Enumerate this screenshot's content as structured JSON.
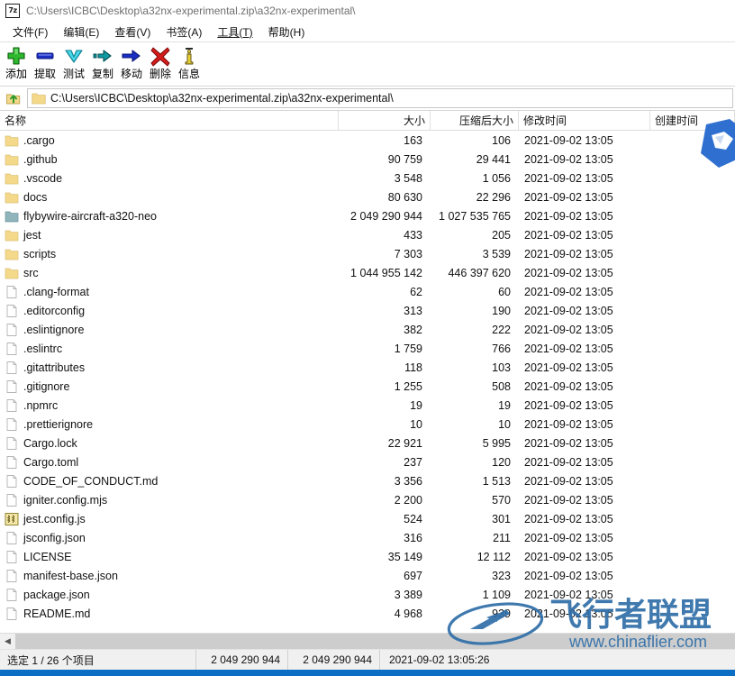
{
  "window": {
    "title": "C:\\Users\\ICBC\\Desktop\\a32nx-experimental.zip\\a32nx-experimental\\",
    "app_icon_text": "7z"
  },
  "menubar": {
    "items": [
      {
        "label": "文件(F)",
        "name": "menu-file"
      },
      {
        "label": "编辑(E)",
        "name": "menu-edit"
      },
      {
        "label": "查看(V)",
        "name": "menu-view"
      },
      {
        "label": "书签(A)",
        "name": "menu-bookmarks"
      },
      {
        "label": "工具(T)",
        "name": "menu-tools"
      },
      {
        "label": "帮助(H)",
        "name": "menu-help"
      }
    ]
  },
  "toolbar": {
    "buttons": [
      {
        "label": "添加",
        "icon": "plus-icon",
        "name": "toolbar-add"
      },
      {
        "label": "提取",
        "icon": "extract-icon",
        "name": "toolbar-extract"
      },
      {
        "label": "测试",
        "icon": "chevron-down-icon",
        "name": "toolbar-test"
      },
      {
        "label": "复制",
        "icon": "copy-arrow-icon",
        "name": "toolbar-copy"
      },
      {
        "label": "移动",
        "icon": "move-arrow-icon",
        "name": "toolbar-move"
      },
      {
        "label": "删除",
        "icon": "delete-x-icon",
        "name": "toolbar-delete"
      },
      {
        "label": "信息",
        "icon": "info-icon",
        "name": "toolbar-info"
      }
    ]
  },
  "addressbar": {
    "up_icon": "up-folder-icon",
    "folder_icon": "folder-icon",
    "path": "C:\\Users\\ICBC\\Desktop\\a32nx-experimental.zip\\a32nx-experimental\\"
  },
  "columns": [
    {
      "key": "name",
      "label": "名称",
      "align": "left"
    },
    {
      "key": "size",
      "label": "大小",
      "align": "right"
    },
    {
      "key": "psize",
      "label": "压缩后大小",
      "align": "right"
    },
    {
      "key": "mtime",
      "label": "修改时间",
      "align": "left"
    },
    {
      "key": "ctime",
      "label": "创建时间",
      "align": "left"
    }
  ],
  "rows": [
    {
      "name": ".cargo",
      "icon": "folder-icon",
      "size": "163",
      "psize": "106",
      "mtime": "2021-09-02 13:05",
      "ctime": "",
      "selected": false
    },
    {
      "name": ".github",
      "icon": "folder-icon",
      "size": "90 759",
      "psize": "29 441",
      "mtime": "2021-09-02 13:05",
      "ctime": "",
      "selected": false
    },
    {
      "name": ".vscode",
      "icon": "folder-icon",
      "size": "3 548",
      "psize": "1 056",
      "mtime": "2021-09-02 13:05",
      "ctime": "",
      "selected": false
    },
    {
      "name": "docs",
      "icon": "folder-icon",
      "size": "80 630",
      "psize": "22 296",
      "mtime": "2021-09-02 13:05",
      "ctime": "",
      "selected": false
    },
    {
      "name": "flybywire-aircraft-a320-neo",
      "icon": "folder-selected-icon",
      "size": "2 049 290 944",
      "psize": "1 027 535 765",
      "mtime": "2021-09-02 13:05",
      "ctime": "",
      "selected": true
    },
    {
      "name": "jest",
      "icon": "folder-icon",
      "size": "433",
      "psize": "205",
      "mtime": "2021-09-02 13:05",
      "ctime": "",
      "selected": false
    },
    {
      "name": "scripts",
      "icon": "folder-icon",
      "size": "7 303",
      "psize": "3 539",
      "mtime": "2021-09-02 13:05",
      "ctime": "",
      "selected": false
    },
    {
      "name": "src",
      "icon": "folder-icon",
      "size": "1 044 955 142",
      "psize": "446 397 620",
      "mtime": "2021-09-02 13:05",
      "ctime": "",
      "selected": false
    },
    {
      "name": ".clang-format",
      "icon": "file-icon",
      "size": "62",
      "psize": "60",
      "mtime": "2021-09-02 13:05",
      "ctime": "",
      "selected": false
    },
    {
      "name": ".editorconfig",
      "icon": "file-icon",
      "size": "313",
      "psize": "190",
      "mtime": "2021-09-02 13:05",
      "ctime": "",
      "selected": false
    },
    {
      "name": ".eslintignore",
      "icon": "file-icon",
      "size": "382",
      "psize": "222",
      "mtime": "2021-09-02 13:05",
      "ctime": "",
      "selected": false
    },
    {
      "name": ".eslintrc",
      "icon": "file-icon",
      "size": "1 759",
      "psize": "766",
      "mtime": "2021-09-02 13:05",
      "ctime": "",
      "selected": false
    },
    {
      "name": ".gitattributes",
      "icon": "file-icon",
      "size": "118",
      "psize": "103",
      "mtime": "2021-09-02 13:05",
      "ctime": "",
      "selected": false
    },
    {
      "name": ".gitignore",
      "icon": "file-icon",
      "size": "1 255",
      "psize": "508",
      "mtime": "2021-09-02 13:05",
      "ctime": "",
      "selected": false
    },
    {
      "name": ".npmrc",
      "icon": "file-icon",
      "size": "19",
      "psize": "19",
      "mtime": "2021-09-02 13:05",
      "ctime": "",
      "selected": false
    },
    {
      "name": ".prettierignore",
      "icon": "file-icon",
      "size": "10",
      "psize": "10",
      "mtime": "2021-09-02 13:05",
      "ctime": "",
      "selected": false
    },
    {
      "name": "Cargo.lock",
      "icon": "file-icon",
      "size": "22 921",
      "psize": "5 995",
      "mtime": "2021-09-02 13:05",
      "ctime": "",
      "selected": false
    },
    {
      "name": "Cargo.toml",
      "icon": "file-icon",
      "size": "237",
      "psize": "120",
      "mtime": "2021-09-02 13:05",
      "ctime": "",
      "selected": false
    },
    {
      "name": "CODE_OF_CONDUCT.md",
      "icon": "file-icon",
      "size": "3 356",
      "psize": "1 513",
      "mtime": "2021-09-02 13:05",
      "ctime": "",
      "selected": false
    },
    {
      "name": "igniter.config.mjs",
      "icon": "file-icon",
      "size": "2 200",
      "psize": "570",
      "mtime": "2021-09-02 13:05",
      "ctime": "",
      "selected": false
    },
    {
      "name": "jest.config.js",
      "icon": "script-js-icon",
      "size": "524",
      "psize": "301",
      "mtime": "2021-09-02 13:05",
      "ctime": "",
      "selected": false
    },
    {
      "name": "jsconfig.json",
      "icon": "file-icon",
      "size": "316",
      "psize": "211",
      "mtime": "2021-09-02 13:05",
      "ctime": "",
      "selected": false
    },
    {
      "name": "LICENSE",
      "icon": "file-icon",
      "size": "35 149",
      "psize": "12 112",
      "mtime": "2021-09-02 13:05",
      "ctime": "",
      "selected": false
    },
    {
      "name": "manifest-base.json",
      "icon": "file-icon",
      "size": "697",
      "psize": "323",
      "mtime": "2021-09-02 13:05",
      "ctime": "",
      "selected": false
    },
    {
      "name": "package.json",
      "icon": "file-icon",
      "size": "3 389",
      "psize": "1 109",
      "mtime": "2021-09-02 13:05",
      "ctime": "",
      "selected": false
    },
    {
      "name": "README.md",
      "icon": "file-icon",
      "size": "4 968",
      "psize": "939",
      "mtime": "2021-09-02 13:05",
      "ctime": "",
      "selected": false
    }
  ],
  "statusbar": {
    "selection": "选定 1 / 26 个项目",
    "size": "2 049 290 944",
    "packed_size": "2 049 290 944",
    "date": "2021-09-02 13:05:26"
  },
  "watermark": {
    "brand": "飞行者联盟",
    "url": "www.chinaflier.com"
  },
  "colors": {
    "accent": "#0b6ec4",
    "folder": "#f5d98a",
    "folder_selected": "#84adb5",
    "title_text": "#6f6f6f",
    "statusbar_bg": "#f0f0f0",
    "watermark": "#2f6ea8"
  }
}
